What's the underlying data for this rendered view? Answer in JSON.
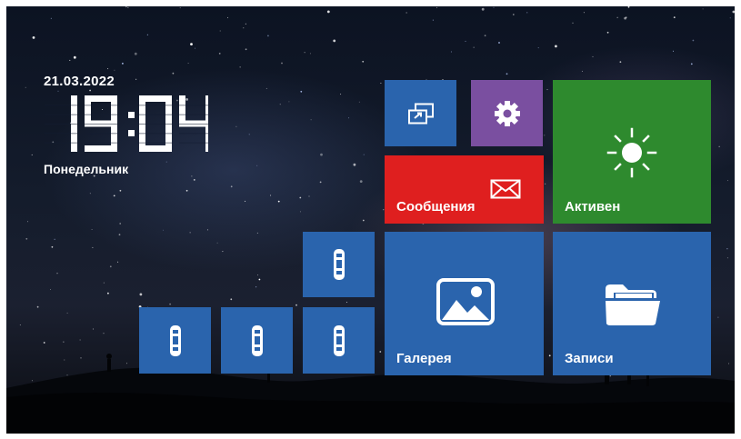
{
  "status": {
    "date": "21.03.2022",
    "time": "19:04",
    "weekday": "Понедельник"
  },
  "tiles": {
    "screen_switch": {
      "icon": "screen-switch-icon",
      "color": "#2a64ad"
    },
    "settings": {
      "icon": "gear-icon",
      "color": "#7a4fa0"
    },
    "messages": {
      "label": "Сообщения",
      "icon": "envelope-icon",
      "color": "#df1f1f"
    },
    "active": {
      "label": "Активен",
      "icon": "sun-icon",
      "color": "#2e8a2e"
    },
    "gallery": {
      "label": "Галерея",
      "icon": "image-icon",
      "color": "#2a64ad"
    },
    "records": {
      "label": "Записи",
      "icon": "folder-icon",
      "color": "#2a64ad"
    },
    "panels": [
      {
        "icon": "door-panel-icon"
      },
      {
        "icon": "door-panel-icon"
      },
      {
        "icon": "door-panel-icon"
      },
      {
        "icon": "door-panel-icon"
      }
    ]
  }
}
